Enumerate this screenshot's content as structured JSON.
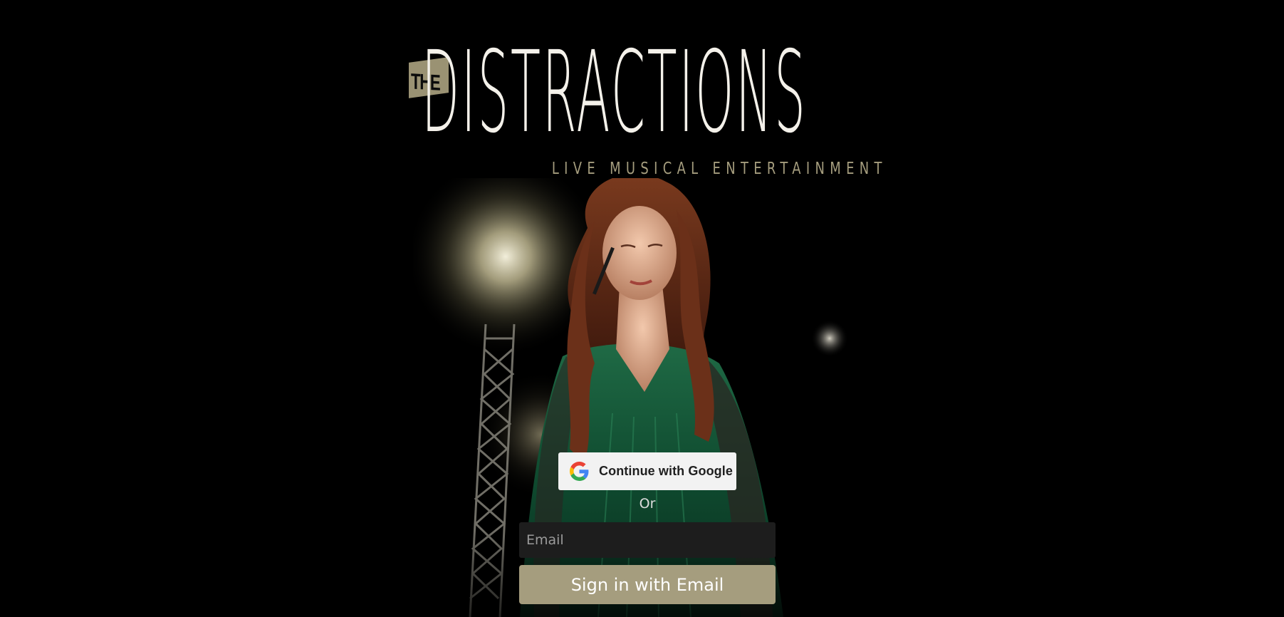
{
  "brand": {
    "logo_prefix": "THE",
    "logo_name": "DISTRACTIONS",
    "tagline": "LIVE MUSICAL ENTERTAINMENT",
    "accent_color": "#a59d7e"
  },
  "hero": {
    "icon": "performer-photo"
  },
  "auth": {
    "google_button_label": "Continue with Google",
    "google_icon": "google-g-icon",
    "divider_text": "Or",
    "email_placeholder": "Email",
    "email_value": "",
    "email_button_label": "Sign in with Email"
  }
}
